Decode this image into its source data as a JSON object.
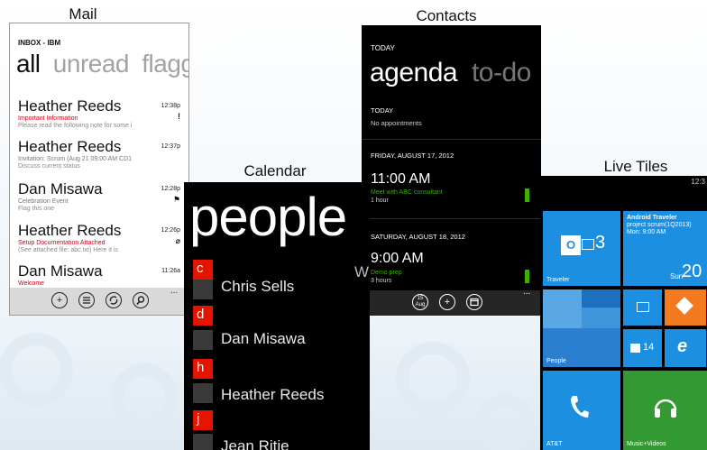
{
  "captions": {
    "mail": "Mail",
    "contacts": "Contacts",
    "calendar": "Calendar",
    "live_tiles": "Live Tiles"
  },
  "mail": {
    "account": "INBOX - IBM",
    "pivots": [
      "all",
      "unread",
      "flagg"
    ],
    "messages": [
      {
        "from": "Heather Reeds",
        "time": "12:38p",
        "subject": "Important Information",
        "preview": "Please read the following note for some i",
        "subject_style": "red",
        "flag": "!"
      },
      {
        "from": "Heather Reeds",
        "time": "12:37p",
        "subject": "Invitation: Scrum (Aug 21 09:00 AM CD1",
        "preview": "Discuss current status",
        "subject_style": "gray",
        "flag": ""
      },
      {
        "from": "Dan Misawa",
        "time": "12:28p",
        "subject": "Celebration Event",
        "preview": "Flag this one",
        "subject_style": "gray",
        "flag": "⚑"
      },
      {
        "from": "Heather Reeds",
        "time": "12:26p",
        "subject": "Setup Documentation Attached",
        "preview": "(See attached file: abc.txt) Here it is",
        "subject_style": "red",
        "flag": "⌀"
      },
      {
        "from": "Dan Misawa",
        "time": "11:26a",
        "subject": "Welcome",
        "preview": "",
        "subject_style": "red",
        "flag": ""
      }
    ],
    "appbar_icons": [
      "new-icon",
      "list-icon",
      "sync-icon",
      "search-icon"
    ],
    "more": "..."
  },
  "people": {
    "title": "people",
    "right_hint": "W",
    "groups": [
      {
        "letter": "c",
        "name": "Chris Sells"
      },
      {
        "letter": "d",
        "name": "Dan Misawa"
      },
      {
        "letter": "h",
        "name": "Heather Reeds"
      },
      {
        "letter": "j",
        "name": "Jean Ritie"
      }
    ]
  },
  "agenda": {
    "header": "TODAY",
    "pivots": [
      "agenda",
      "to-do"
    ],
    "today_label": "TODAY",
    "today_text": "No appointments",
    "days": [
      {
        "date": "FRIDAY, AUGUST 17, 2012",
        "time": "11:00 AM",
        "title": "Meet with ABC consultant",
        "duration": "1 hour"
      },
      {
        "date": "SATURDAY, AUGUST 18, 2012",
        "time": "9:00 AM",
        "title": "Demo prep",
        "duration": "3 hours"
      }
    ],
    "appbar": {
      "today_btn": "15",
      "today_btn_sub": "Aug"
    },
    "more": "..."
  },
  "tiles": {
    "status_time": "12:3",
    "traveler": {
      "label": "Traveler",
      "badge": "3"
    },
    "calendar_tile": {
      "line1": "Android Traveler",
      "line2": "project scrum(1Q2013)",
      "line3": "Mon: 9:00 AM",
      "day": "Sun",
      "date": "20"
    },
    "people": {
      "label": "People"
    },
    "store": {
      "count": "14"
    },
    "att": {
      "label": "AT&T"
    },
    "music": {
      "label": "Music+Videos"
    },
    "colors": {
      "blue": "#1d8fe0",
      "orange": "#f47a20",
      "green": "#339933"
    }
  }
}
